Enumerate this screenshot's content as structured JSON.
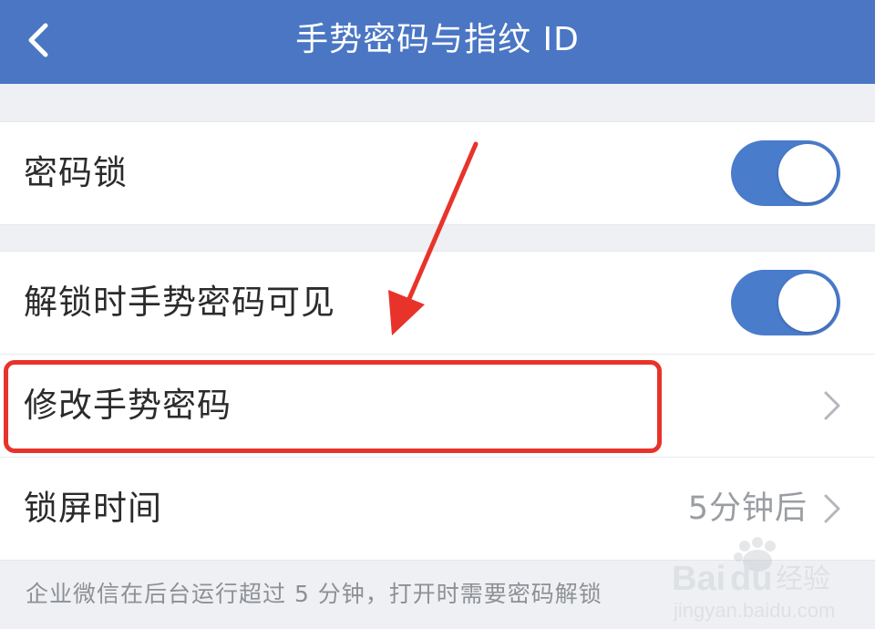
{
  "header": {
    "title": "手势密码与指纹 ID",
    "back_icon": "chevron-left-icon",
    "background": "#4a76c4"
  },
  "group1": {
    "rows": [
      {
        "label": "密码锁",
        "toggle_on": true
      }
    ]
  },
  "group2": {
    "rows": [
      {
        "label": "解锁时手势密码可见",
        "toggle_on": true
      },
      {
        "label": "修改手势密码",
        "icon": "chevron-right-icon"
      },
      {
        "label": "锁屏时间",
        "value": "5分钟后",
        "icon": "chevron-right-icon"
      }
    ]
  },
  "footnote": "企业微信在后台运行超过 5 分钟，打开时需要密码解锁",
  "colors": {
    "accent": "#4a7ccc",
    "annotation": "#e8332b"
  },
  "watermark": {
    "brand": "Baidu经验",
    "url": "jingyan.baidu.com"
  }
}
